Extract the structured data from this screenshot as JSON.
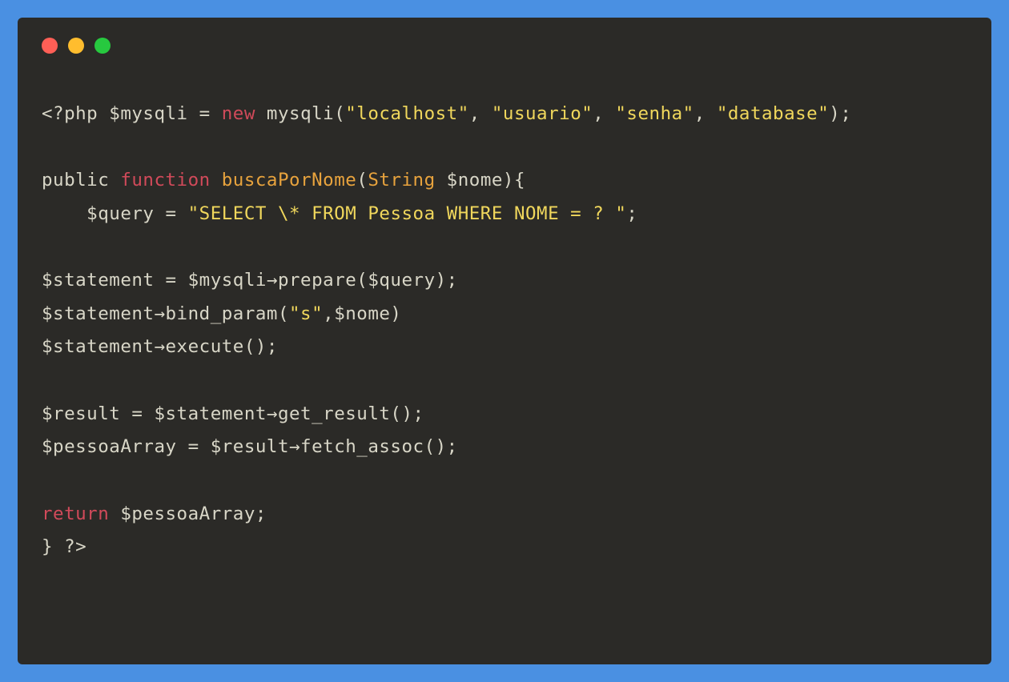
{
  "colors": {
    "frame_bg": "#4a90e2",
    "window_bg": "#2b2a27",
    "red": "#ff5f56",
    "yellow": "#ffbd2e",
    "green": "#27c93f",
    "text_default": "#d8d6c7",
    "text_keyword": "#d14a5a",
    "text_orange": "#e8a33d",
    "text_string": "#f0d75c"
  },
  "code": {
    "l1": {
      "t1": "<?php $mysqli = ",
      "t2": "new",
      "t3": " mysqli(",
      "t4": "\"localhost\"",
      "t5": ", ",
      "t6": "\"usuario\"",
      "t7": ", ",
      "t8": "\"senha\"",
      "t9": ", ",
      "t10": "\"database\"",
      "t11": ");"
    },
    "l3": {
      "t1": "public ",
      "t2": "function",
      "t3": " ",
      "t4": "buscaPorNome",
      "t5": "(",
      "t6": "String",
      "t7": " $nome){"
    },
    "l4": {
      "t1": "    $query = ",
      "t2": "\"SELECT \\* FROM Pessoa WHERE NOME = ? \"",
      "t3": ";"
    },
    "l6": {
      "t1": "$statement = $mysqli→prepare($query);"
    },
    "l7": {
      "t1": "$statement→bind_param(",
      "t2": "\"s\"",
      "t3": ",$nome)"
    },
    "l8": {
      "t1": "$statement→execute();"
    },
    "l10": {
      "t1": "$result = $statement→get_result();"
    },
    "l11": {
      "t1": "$pessoaArray = $result→fetch_assoc();"
    },
    "l13": {
      "t1": "return",
      "t2": " $pessoaArray;"
    },
    "l14": {
      "t1": "} ?>"
    }
  }
}
